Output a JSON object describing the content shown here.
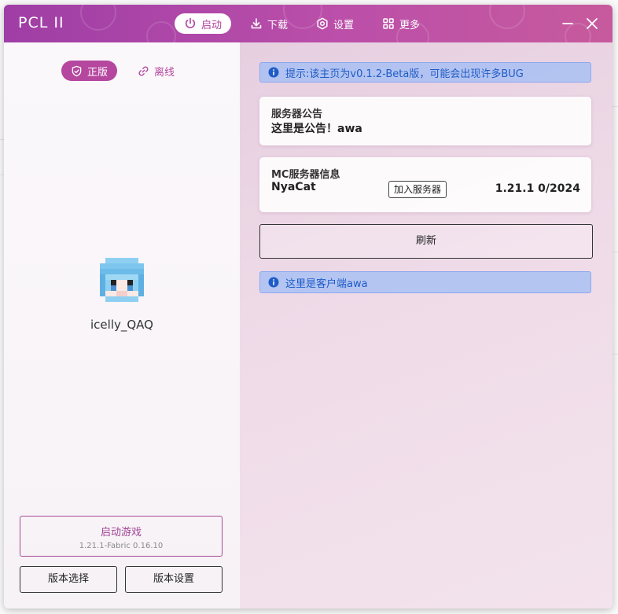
{
  "app": {
    "title": "PCL II"
  },
  "nav": [
    {
      "label": "启动",
      "icon": "power-icon",
      "active": true
    },
    {
      "label": "下载",
      "icon": "download-icon",
      "active": false
    },
    {
      "label": "设置",
      "icon": "gear-icon",
      "active": false
    },
    {
      "label": "更多",
      "icon": "grid-icon",
      "active": false
    }
  ],
  "window_controls": {
    "minimize_icon": "minimize-icon",
    "close_icon": "close-icon"
  },
  "account": {
    "mode_official": "正版",
    "mode_offline": "离线",
    "active_mode": "official",
    "player_name": "icelly_QAQ"
  },
  "launch": {
    "label": "启动游戏",
    "version": "1.21.1-Fabric 0.16.10",
    "select_version": "版本选择",
    "version_settings": "版本设置"
  },
  "main": {
    "hint_top": "提示:该主页为v0.1.2-Beta版，可能会出现许多BUG",
    "announcement": {
      "title": "服务器公告",
      "body": "这里是公告！awa"
    },
    "server": {
      "title": "MC服务器信息",
      "name": "NyaCat",
      "join_label": "加入服务器",
      "status": "1.21.1 0/2024"
    },
    "refresh_label": "刷新",
    "hint_bottom": "这里是客户端awa"
  },
  "colors": {
    "accent": "#b5479f",
    "titlebar_start": "#9f3ea6",
    "titlebar_end": "#c75a9d",
    "hint_bg": "#a0bef5",
    "hint_text": "#1e5bc6"
  }
}
